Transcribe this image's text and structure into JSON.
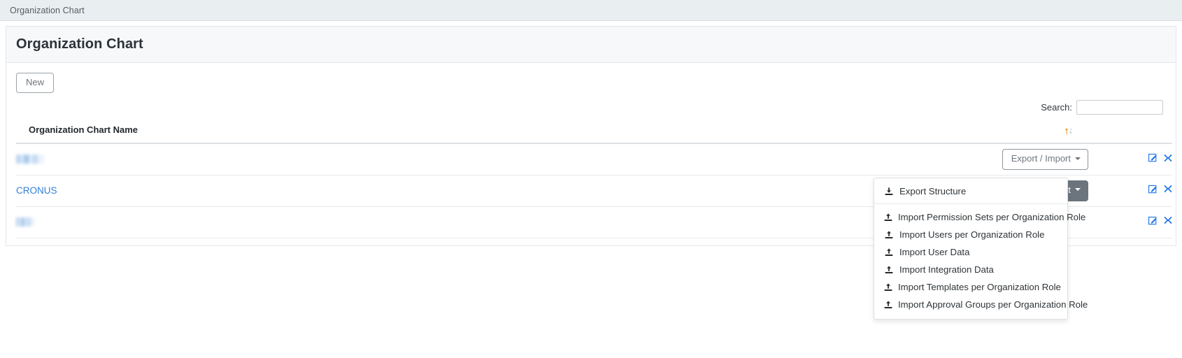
{
  "topbar": {
    "breadcrumb": "Organization Chart"
  },
  "card": {
    "title": "Organization Chart"
  },
  "toolbar": {
    "new_label": "New"
  },
  "search": {
    "label": "Search:",
    "value": "",
    "placeholder": ""
  },
  "table": {
    "columns": [
      "Organization Chart Name",
      "",
      ""
    ],
    "sort_icon": "sort-asc-desc-icon",
    "rows": [
      {
        "name": "",
        "redacted": true,
        "redacted_width": "w1",
        "action_label": "Export / Import",
        "action_state": "outline",
        "edit_icon": "edit-icon",
        "delete_icon": "delete-icon"
      },
      {
        "name": "CRONUS",
        "redacted": false,
        "redacted_width": "",
        "action_label": "Export / Import",
        "action_state": "filled",
        "edit_icon": "edit-icon",
        "delete_icon": "delete-icon"
      },
      {
        "name": "",
        "redacted": true,
        "redacted_width": "w2",
        "action_label": "",
        "action_state": "hidden",
        "edit_icon": "edit-icon",
        "delete_icon": "delete-icon"
      }
    ]
  },
  "dropdown": {
    "open": true,
    "groups": [
      {
        "items": [
          {
            "label": "Export Structure",
            "icon": "download-icon"
          }
        ]
      },
      {
        "items": [
          {
            "label": "Import Permission Sets per Organization Role",
            "icon": "upload-icon"
          },
          {
            "label": "Import Users per Organization Role",
            "icon": "upload-icon"
          },
          {
            "label": "Import User Data",
            "icon": "upload-icon"
          },
          {
            "label": "Import Integration Data",
            "icon": "upload-icon"
          },
          {
            "label": "Import Templates per Organization Role",
            "icon": "upload-icon"
          },
          {
            "label": "Import Approval Groups per Organization Role",
            "icon": "upload-icon"
          }
        ]
      }
    ]
  },
  "colors": {
    "topbar_bg": "#e9eef1",
    "link": "#2f7fd8",
    "button_filled": "#6c757d",
    "icon_blue": "#1a73e8",
    "sort_active": "#e8a33d"
  }
}
